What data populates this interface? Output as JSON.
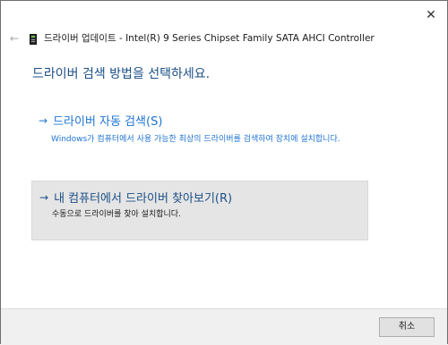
{
  "window": {
    "close_glyph": "✕"
  },
  "titlebar": {
    "back_glyph": "←",
    "device_icon": "device-manager-icon",
    "title": "드라이버 업데이트 - Intel(R) 9 Series Chipset Family SATA AHCI Controller"
  },
  "heading": "드라이버 검색 방법을 선택하세요.",
  "options": [
    {
      "arrow": "→",
      "title": "드라이버 자동 검색(S)",
      "description": "Windows가 컴퓨터에서 사용 가능한 최상의 드라이버를 검색하여 장치에 설치합니다."
    },
    {
      "arrow": "→",
      "title": "내 컴퓨터에서 드라이버 찾아보기(R)",
      "description": "수동으로 드라이버를 찾아 설치합니다."
    }
  ],
  "footer": {
    "cancel_label": "취소"
  },
  "colors": {
    "link_blue": "#1e73d2",
    "heading_blue": "#1b4f86",
    "hover_bg": "#e5e5e5"
  }
}
